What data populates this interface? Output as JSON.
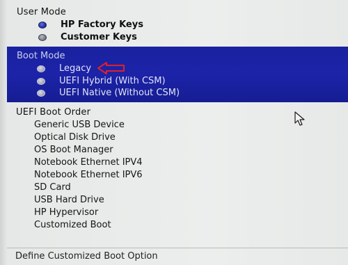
{
  "user_mode": {
    "title": "User Mode",
    "options": [
      {
        "label": "HP Factory Keys",
        "selected": true
      },
      {
        "label": "Customer Keys",
        "selected": false
      }
    ]
  },
  "boot_mode": {
    "title": "Boot Mode",
    "options": [
      {
        "label": "Legacy",
        "selected": false
      },
      {
        "label": "UEFI Hybrid (With CSM)",
        "selected": false
      },
      {
        "label": "UEFI Native (Without CSM)",
        "selected": false
      }
    ]
  },
  "uefi_boot_order": {
    "title": "UEFI Boot Order",
    "items": [
      "Generic USB Device",
      "Optical Disk Drive",
      "OS Boot Manager",
      "Notebook Ethernet IPV4",
      "Notebook Ethernet IPV6",
      "SD Card",
      "USB Hard Drive",
      "HP Hypervisor",
      "Customized Boot"
    ]
  },
  "footer": {
    "define_option": "Define Customized Boot Option"
  },
  "colors": {
    "highlight_band": "#1c23a8",
    "annotation_arrow": "#e0202a"
  },
  "icons": {
    "annotation": "red-arrow-icon",
    "cursor": "mouse-pointer-icon"
  }
}
